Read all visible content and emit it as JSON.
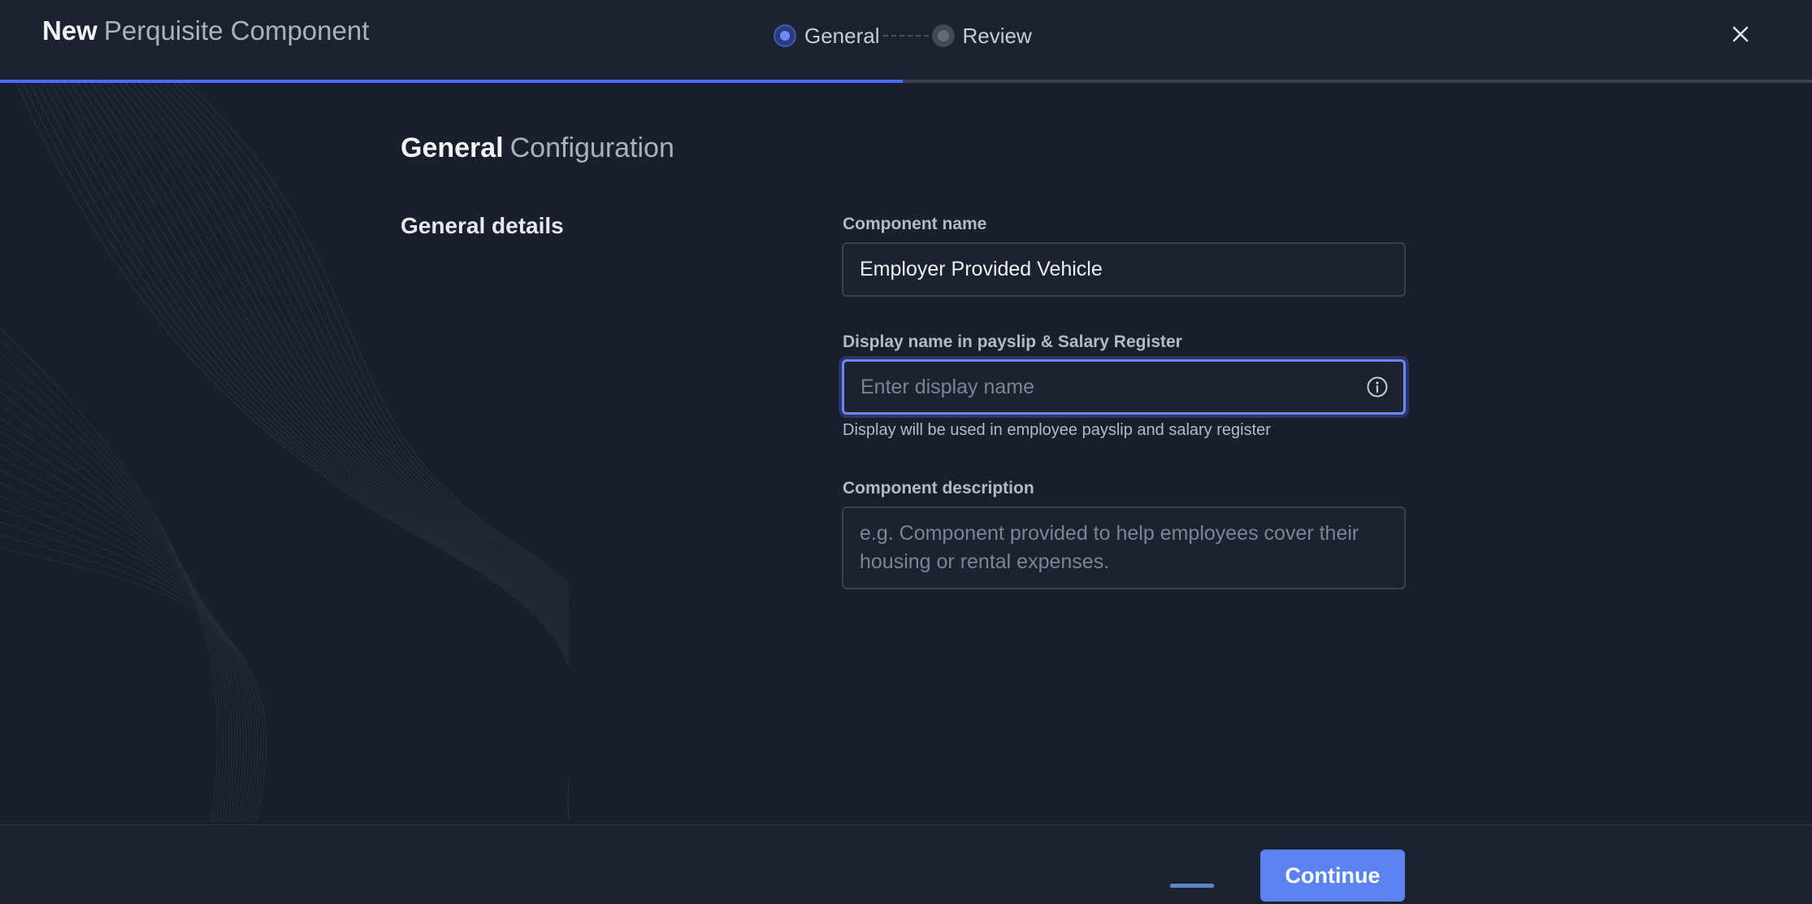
{
  "header": {
    "title_bold": "New",
    "title_light": "Perquisite Component",
    "steps": [
      {
        "label": "General",
        "state": "active"
      },
      {
        "label": "Review",
        "state": "inactive"
      }
    ],
    "close_icon": "close-icon",
    "progress_fraction": 0.5
  },
  "section": {
    "title_bold": "General",
    "title_light": "Configuration",
    "group_title": "General details"
  },
  "fields": {
    "component_name": {
      "label": "Component name",
      "value": "Employer Provided Vehicle"
    },
    "display_name": {
      "label": "Display name in payslip & Salary Register",
      "placeholder": "Enter display name",
      "helper": "Display will be used in employee payslip and salary register",
      "icon": "info-icon"
    },
    "description": {
      "label": "Component description",
      "placeholder": "e.g. Component provided to help employees cover their housing or rental expenses."
    }
  },
  "footer": {
    "continue_label": "Continue"
  },
  "colors": {
    "accent": "#4b6dff",
    "button": "#5a82f0",
    "background": "#1a1f2b"
  }
}
